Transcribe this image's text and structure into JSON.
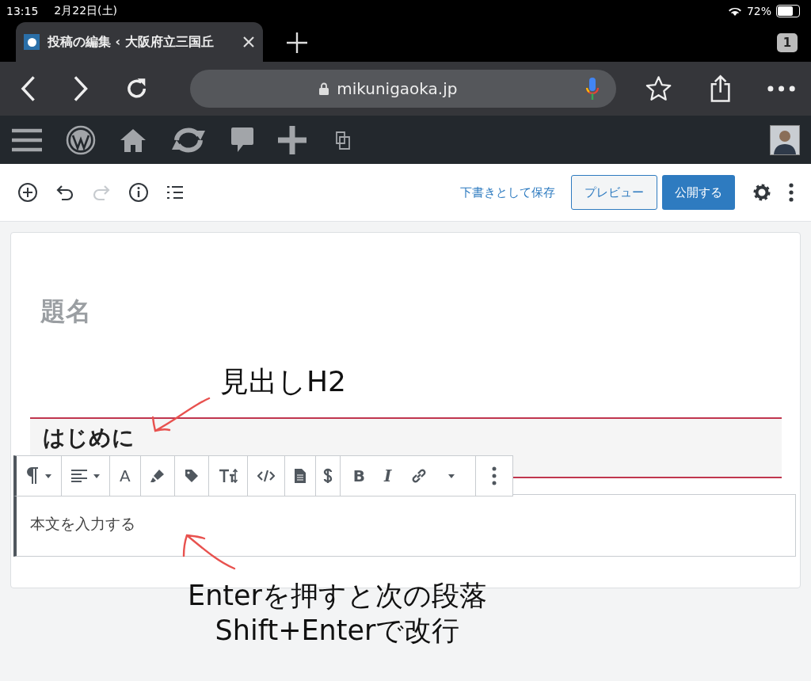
{
  "status_bar": {
    "time": "13:15",
    "date": "2月22日(土)",
    "battery": "72%"
  },
  "browser": {
    "tab": {
      "title": "投稿の編集 ‹ 大阪府立三国丘",
      "selected": true
    },
    "tab_count": "1",
    "url": "mikunigaoka.jp"
  },
  "admin_bar": {
    "icons": [
      {
        "kind": "menu"
      },
      {
        "kind": "wordpress"
      },
      {
        "kind": "home"
      },
      {
        "kind": "sync"
      },
      {
        "kind": "comment"
      },
      {
        "kind": "plus"
      },
      {
        "kind": "copy"
      }
    ]
  },
  "editor_toolbar": {
    "tools": [
      {
        "kind": "add",
        "disabled": false
      },
      {
        "kind": "undo",
        "disabled": false
      },
      {
        "kind": "redo",
        "disabled": true
      },
      {
        "kind": "info",
        "disabled": false
      },
      {
        "kind": "outline",
        "disabled": false
      }
    ],
    "save_draft": "下書きとして保存",
    "preview": "プレビュー",
    "publish": "公開する"
  },
  "editor": {
    "title_placeholder": "題名",
    "heading": "はじめに",
    "paragraph": "本文を入力する",
    "format_toolbar": [
      {
        "kind": "paragraph",
        "caret": true
      },
      {
        "kind": "align",
        "caret": true
      },
      {
        "kind": "letter",
        "label": "A"
      },
      {
        "kind": "highlighter"
      },
      {
        "kind": "tag"
      },
      {
        "kind": "textsize"
      },
      {
        "kind": "code"
      },
      {
        "kind": "document"
      },
      {
        "kind": "dollar"
      },
      {
        "kind": "bold",
        "label": "B"
      },
      {
        "kind": "italic",
        "label": "I"
      },
      {
        "kind": "link",
        "caret": true
      },
      {
        "kind": "more"
      }
    ]
  },
  "annotations": {
    "heading_note": "見出しH2",
    "paragraph_note": [
      "Enterを押すと次の段落",
      "Shift+Enterで改行"
    ]
  }
}
